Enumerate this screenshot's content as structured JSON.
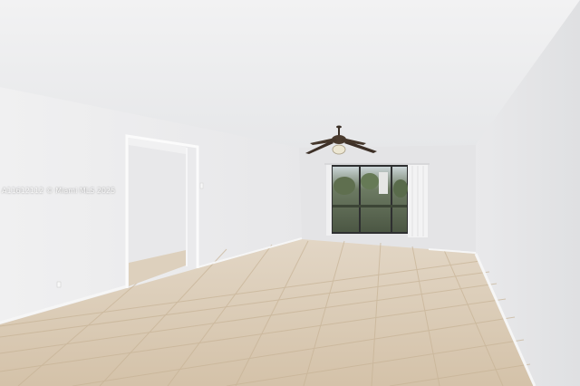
{
  "photo": {
    "subject": "Empty living room with tiled floor, ceiling fan and sliding glass doors",
    "watermark": "A11612112 © Miami MLS 2025"
  },
  "colors": {
    "ceiling": "#efeff0",
    "wall_left": "#ececee",
    "wall_back": "#e6e6e8",
    "wall_right": "#e2e3e5",
    "floor": "#d9c9b3",
    "grout": "#c9b69c",
    "baseboard": "#f4f4f4",
    "glass": "#56624f",
    "fan": "#4a3b2e"
  }
}
